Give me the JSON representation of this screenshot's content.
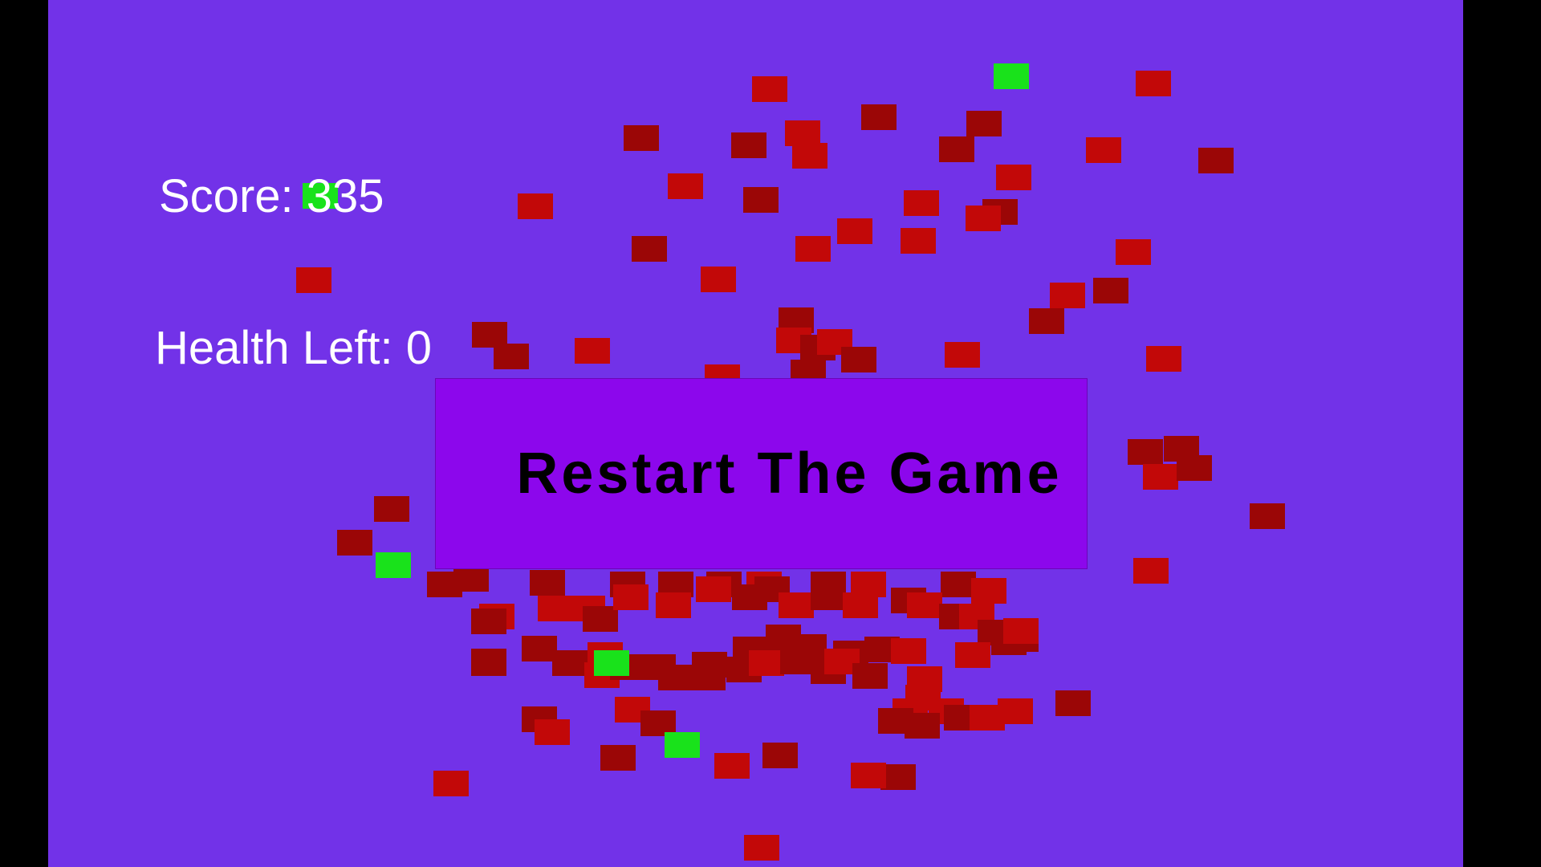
{
  "hud": {
    "score_text": "Score: 335",
    "health_text": "Health Left: 0"
  },
  "restart_button": {
    "label": "Restart The Game"
  },
  "colors": {
    "background": "#7232e8",
    "letterbox": "#000000",
    "enemy_cube_bright": "#c20808",
    "enemy_cube_dark": "#9b0606",
    "pickup_cube": "#19e21b",
    "button_fill": "#8c07ec",
    "hud_text": "#ffffff",
    "button_text": "#000000"
  }
}
